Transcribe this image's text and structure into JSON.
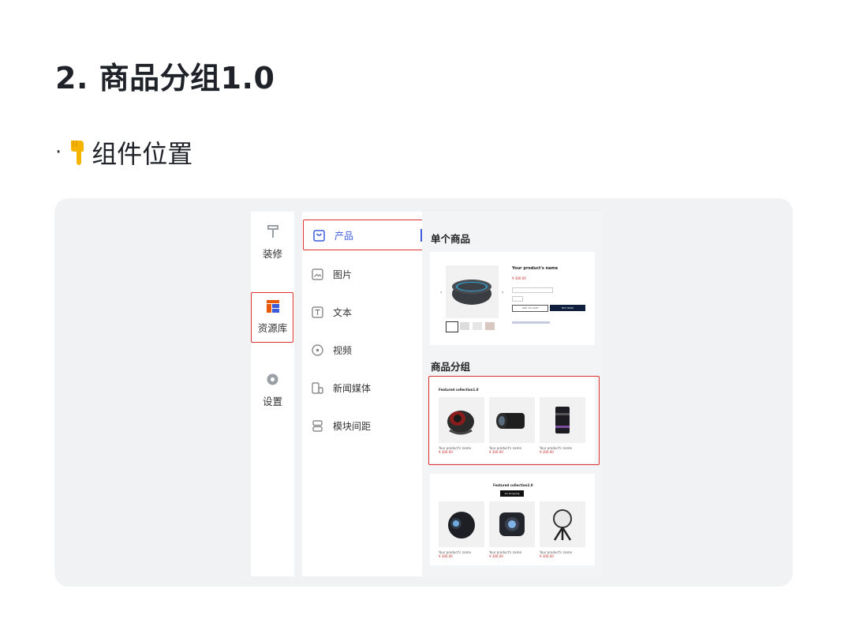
{
  "doc": {
    "heading": "2. 商品分组1.0",
    "bullet_text": "组件位置",
    "bullet_icon": "pointing-down-hand-emoji"
  },
  "editor": {
    "nav": [
      {
        "label": "装修",
        "icon": "paint-roller-icon"
      },
      {
        "label": "资源库",
        "icon": "layout-grid-icon"
      },
      {
        "label": "设置",
        "icon": "gear-icon"
      }
    ],
    "panel": [
      {
        "label": "产品",
        "icon": "bag-icon"
      },
      {
        "label": "图片",
        "icon": "image-icon"
      },
      {
        "label": "文本",
        "icon": "text-icon"
      },
      {
        "label": "视频",
        "icon": "play-circle-icon"
      },
      {
        "label": "新闻媒体",
        "icon": "news-icon"
      },
      {
        "label": "模块间距",
        "icon": "spacing-icon"
      }
    ],
    "accent_color": "#3b5bdb",
    "highlight_color": "#e03131",
    "section_single": "单个商品",
    "section_group": "商品分组",
    "single_product": {
      "name": "Your product's name",
      "price": "¥ 300.00",
      "add_to_cart": "ADD TO CART",
      "buy_now": "BUY NOW"
    },
    "collection1": {
      "title": "Featured collection1.0",
      "items": [
        {
          "name": "Your product's name",
          "price": "¥ 300.00"
        },
        {
          "name": "Your product's name",
          "price": "¥ 300.00"
        },
        {
          "name": "Your product's name",
          "price": "¥ 300.00"
        }
      ]
    },
    "collection2": {
      "title": "Featured collection2.0",
      "button": "Go shopping",
      "items": [
        {
          "name": "Your product's name",
          "price": "¥ 300.00"
        },
        {
          "name": "Your product's name",
          "price": "¥ 300.00"
        },
        {
          "name": "Your product's name",
          "price": "¥ 300.00"
        }
      ]
    }
  }
}
